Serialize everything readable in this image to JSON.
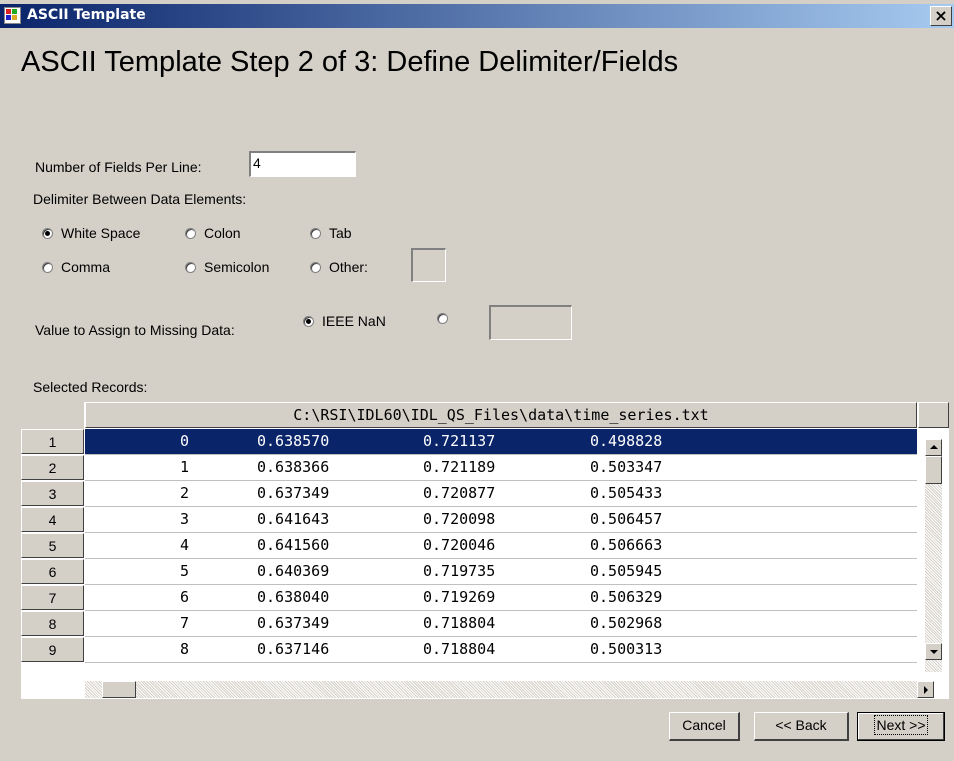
{
  "window": {
    "title": "ASCII Template",
    "close_label": "×"
  },
  "heading": "ASCII Template Step 2 of 3: Define Delimiter/Fields",
  "fields": {
    "label": "Number of Fields Per Line:",
    "value": "4"
  },
  "delimiter": {
    "label": "Delimiter Between Data Elements:",
    "options": [
      "White Space",
      "Colon",
      "Tab",
      "Comma",
      "Semicolon",
      "Other:"
    ],
    "selected": "White Space",
    "other_value": ""
  },
  "missing": {
    "label": "Value to Assign to Missing Data:",
    "option_nan": "IEEE NaN",
    "selected": "IEEE NaN",
    "custom_value": ""
  },
  "records": {
    "label": "Selected Records:",
    "file_path": "C:\\RSI\\IDL60\\IDL_QS_Files\\data\\time_series.txt",
    "selected_row": 1,
    "rows": [
      {
        "n": "1",
        "cells": [
          "0",
          "0.638570",
          "0.721137",
          "0.498828"
        ]
      },
      {
        "n": "2",
        "cells": [
          "1",
          "0.638366",
          "0.721189",
          "0.503347"
        ]
      },
      {
        "n": "3",
        "cells": [
          "2",
          "0.637349",
          "0.720877",
          "0.505433"
        ]
      },
      {
        "n": "4",
        "cells": [
          "3",
          "0.641643",
          "0.720098",
          "0.506457"
        ]
      },
      {
        "n": "5",
        "cells": [
          "4",
          "0.641560",
          "0.720046",
          "0.506663"
        ]
      },
      {
        "n": "6",
        "cells": [
          "5",
          "0.640369",
          "0.719735",
          "0.505945"
        ]
      },
      {
        "n": "7",
        "cells": [
          "6",
          "0.638040",
          "0.719269",
          "0.506329"
        ]
      },
      {
        "n": "8",
        "cells": [
          "7",
          "0.637349",
          "0.718804",
          "0.502968"
        ]
      },
      {
        "n": "9",
        "cells": [
          "8",
          "0.637146",
          "0.718804",
          "0.500313"
        ]
      }
    ]
  },
  "buttons": {
    "cancel": "Cancel",
    "back": "<< Back",
    "next": "Next >>"
  },
  "icons": {
    "app": "ascii-template-icon",
    "close": "close-icon",
    "scroll_up": "arrow-up-icon",
    "scroll_down": "arrow-down-icon",
    "scroll_left": "arrow-left-icon",
    "scroll_right": "arrow-right-icon"
  },
  "colors": {
    "titlebar_start": "#0a246a",
    "titlebar_end": "#a6caf0",
    "selection": "#0a246a",
    "face": "#d4d0c8"
  }
}
